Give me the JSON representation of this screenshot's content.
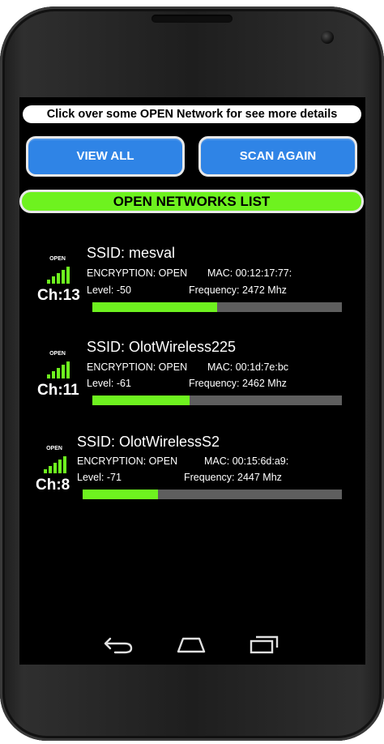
{
  "hint": "Click over some OPEN Network for see more details",
  "buttons": {
    "view_all": "VIEW ALL",
    "scan_again": "SCAN AGAIN"
  },
  "list_title": "OPEN NETWORKS LIST",
  "networks": [
    {
      "badge": "OPEN",
      "channel": "Ch:13",
      "ssid": "SSID: mesval",
      "encryption": "ENCRYPTION: OPEN",
      "mac": "MAC: 00:12:17:77:",
      "level": "Level: -50",
      "frequency": "Frequency: 2472 Mhz",
      "signal_fraction": 0.5
    },
    {
      "badge": "OPEN",
      "channel": "Ch:11",
      "ssid": "SSID: OlotWireless225",
      "encryption": "ENCRYPTION: OPEN",
      "mac": "MAC: 00:1d:7e:bc",
      "level": "Level: -61",
      "frequency": "Frequency: 2462 Mhz",
      "signal_fraction": 0.39
    },
    {
      "badge": "OPEN",
      "channel": "Ch:8",
      "ssid": "SSID: OlotWirelessS2",
      "encryption": "ENCRYPTION: OPEN",
      "mac": "MAC: 00:15:6d:a9:",
      "level": "Level: -71",
      "frequency": "Frequency: 2447 Mhz",
      "signal_fraction": 0.29
    }
  ],
  "navbar": {
    "back": "back-icon",
    "home": "home-icon",
    "recents": "recents-icon"
  },
  "colors": {
    "accent_green": "#6ef21f",
    "button_blue": "#2f84e6",
    "track_gray": "#5e5e5e"
  }
}
